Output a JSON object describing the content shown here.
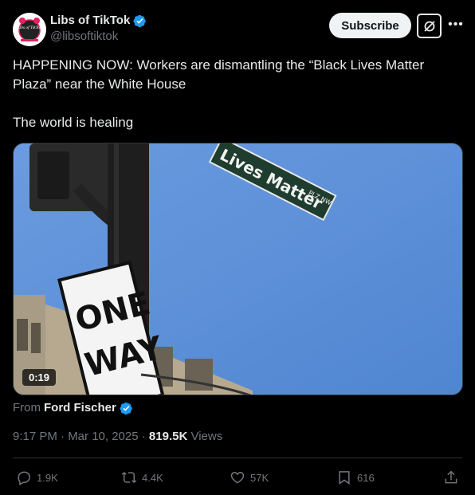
{
  "author": {
    "display_name": "Libs of TikTok",
    "handle": "@libsoftiktok",
    "avatar_text": "Libs of TikTok",
    "verified_icon": "verified-badge-icon"
  },
  "header": {
    "subscribe_label": "Subscribe",
    "grok_icon": "grok-icon",
    "more_icon": "more-icon"
  },
  "tweet": {
    "line1": "HAPPENING NOW: Workers are dismantling the “Black Lives Matter Plaza” near the White House",
    "line2": "The world is healing"
  },
  "media": {
    "duration": "0:19",
    "street_sign_text": "Lives Matter",
    "street_sign_suffix": "PLZ NW",
    "one_way_text_1": "ONE",
    "one_way_text_2": "WAY"
  },
  "source": {
    "prefix": "From",
    "name": "Ford Fischer"
  },
  "meta": {
    "time": "9:17 PM · Mar 10, 2025 · ",
    "views_count": "819.5K",
    "views_label": " Views"
  },
  "actions": {
    "replies": "1.9K",
    "reposts": "4.4K",
    "likes": "57K",
    "bookmarks": "616"
  },
  "colors": {
    "background": "#000000",
    "text": "#e7e9ea",
    "muted": "#71767b",
    "verified": "#1d9bf0",
    "sky": "#5a8ed6"
  }
}
